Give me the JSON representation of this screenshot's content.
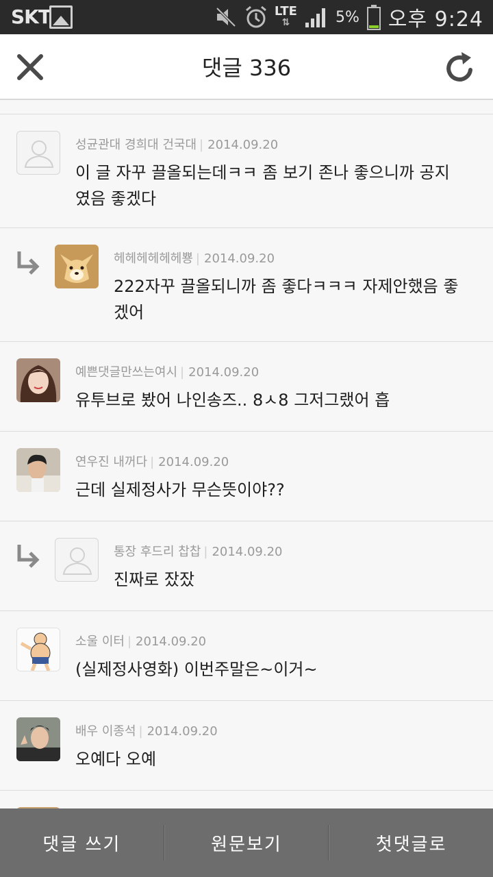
{
  "status_bar": {
    "carrier": "SKT",
    "network": "LTE",
    "battery": "5%",
    "time": "오후 9:24",
    "icons": [
      "gallery-icon",
      "mute-icon",
      "alarm-icon",
      "lte-icon",
      "signal-icon",
      "battery-icon"
    ]
  },
  "header": {
    "title": "댓글 336",
    "close_icon": "close-icon",
    "refresh_icon": "refresh-icon"
  },
  "comments": [
    {
      "author": "성균관대 경희대 건국대",
      "date": "2014.09.20",
      "text": "이 글 자꾸 끌올되는데ㅋㅋ 좀 보기 존나 좋으니까 공지였음 좋겠다",
      "reply": false,
      "avatar": "default"
    },
    {
      "author": "헤헤헤헤헤헤뿅",
      "date": "2014.09.20",
      "text": "222자꾸 끌올되니까 좀 좋다ㅋㅋㅋ 자제안했음 좋겠어",
      "reply": true,
      "avatar": "doge"
    },
    {
      "author": "예쁜댓글만쓰는여시",
      "date": "2014.09.20",
      "text": "유투브로 봤어 나인송즈.. 8ㅅ8 그저그랬어 흡",
      "reply": false,
      "avatar": "woman"
    },
    {
      "author": "연우진 내꺼다",
      "date": "2014.09.20",
      "text": "근데 실제정사가 무슨뜻이야??",
      "reply": false,
      "avatar": "man"
    },
    {
      "author": "통장 후드리 찹찹",
      "date": "2014.09.20",
      "text": "진짜로 잤잤",
      "reply": true,
      "avatar": "default"
    },
    {
      "author": "소울 이터",
      "date": "2014.09.20",
      "text": "(실제정사영화) 이번주말은~이거~",
      "reply": false,
      "avatar": "cartoon"
    },
    {
      "author": "배우 이종석",
      "date": "2014.09.20",
      "text": "오예다 오예",
      "reply": false,
      "avatar": "actor"
    }
  ],
  "bottom_bar": {
    "write": "댓글 쓰기",
    "original": "원문보기",
    "first": "첫댓글로"
  },
  "colors": {
    "status_bar": "#2a2a2a",
    "header_bg": "#ffffff",
    "list_bg": "#f7f7f7",
    "meta_text": "#9a9a9a",
    "bottom_bar": "#6d6d6d"
  }
}
